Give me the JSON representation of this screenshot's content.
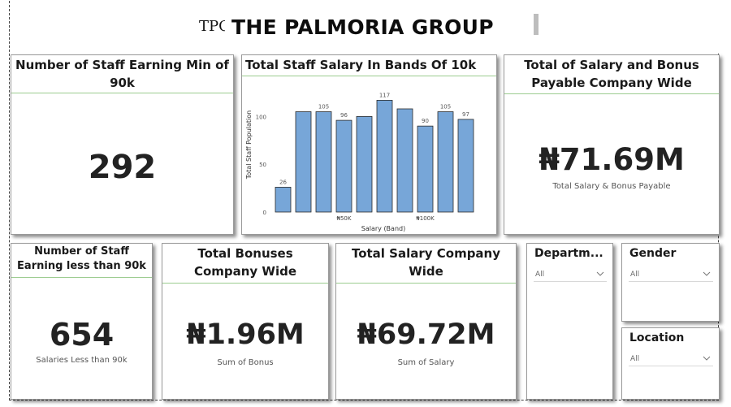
{
  "header": {
    "title": "THE PALMORIA GROUP",
    "logo_text": "TPG"
  },
  "cards": {
    "staff_min_90k": {
      "title": "Number of Staff Earning Min of 90k",
      "value": "292"
    },
    "salary_bonus_total": {
      "title": "Total of Salary and Bonus Payable Company Wide",
      "value": "₦71.69M",
      "subtitle": "Total Salary & Bonus Payable"
    },
    "staff_less_90k": {
      "title": "Number of Staff Earning less than 90k",
      "value": "654",
      "subtitle": "Salaries Less than 90k"
    },
    "bonuses_total": {
      "title": "Total Bonuses Company Wide",
      "value": "₦1.96M",
      "subtitle": "Sum of Bonus"
    },
    "salary_total": {
      "title": "Total Salary Company Wide",
      "value": "₦69.72M",
      "subtitle": "Sum of Salary"
    }
  },
  "slicers": {
    "department": {
      "title": "Departm...",
      "selected": "All"
    },
    "gender": {
      "title": "Gender",
      "selected": "All"
    },
    "location": {
      "title": "Location",
      "selected": "All"
    }
  },
  "colors": {
    "bar": "#77a6d8",
    "bar_stroke": "#2b2b2b",
    "rule": "#9ccc90"
  },
  "chart_data": {
    "type": "bar",
    "title": "Total Staff Salary In Bands Of 10k",
    "xlabel": "Salary (Band)",
    "ylabel": "Total Staff Population",
    "categories": [
      "",
      "",
      "",
      "₦50K",
      "",
      "",
      "",
      "₦100K",
      "",
      ""
    ],
    "values": [
      26,
      105,
      105,
      96,
      100,
      117,
      108,
      90,
      105,
      97
    ],
    "data_labels": [
      "26",
      "",
      "105",
      "96",
      "",
      "117",
      "",
      "90",
      "105",
      "97"
    ],
    "yticks": [
      0,
      50,
      100
    ],
    "ylim": [
      0,
      125
    ],
    "grid": false
  }
}
